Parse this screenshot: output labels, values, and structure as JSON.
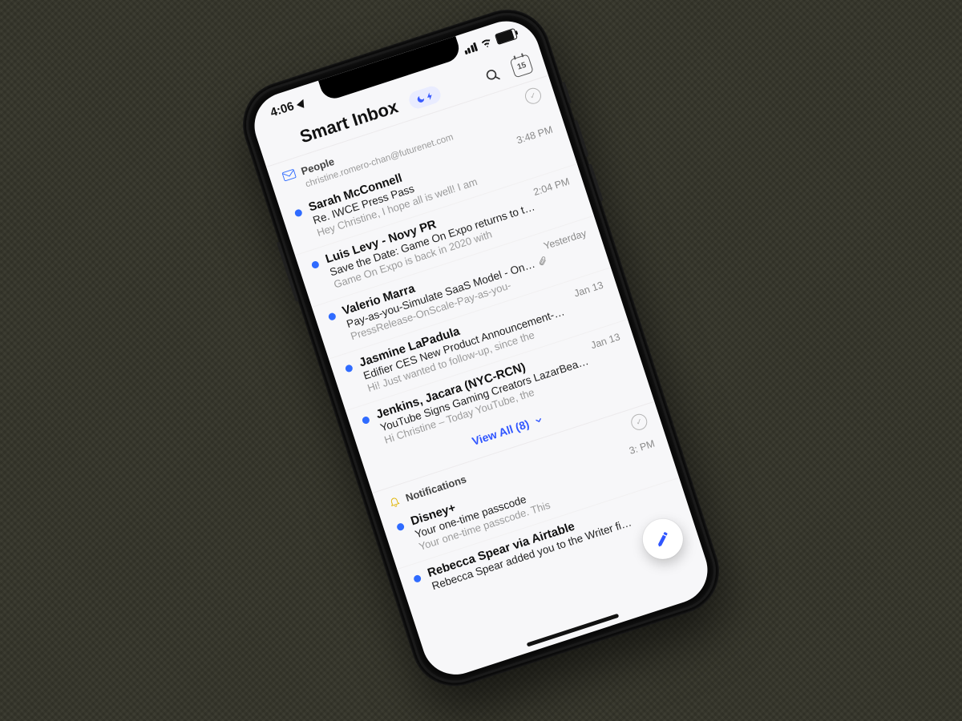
{
  "status": {
    "time": "4:06",
    "calendar_day": "15"
  },
  "header": {
    "title": "Smart Inbox"
  },
  "sections": [
    {
      "key": "people",
      "label": "People",
      "sub": "christine.romero-chan@futurenet.com",
      "view_all_label": "View All (8)",
      "messages": [
        {
          "from": "Sarah McConnell",
          "time": "3:48 PM",
          "subject": "Re. IWCE Press Pass",
          "preview": "Hey Christine, I hope all is well! I am",
          "unread": true,
          "attachment": false
        },
        {
          "from": "Luis Levy - Novy PR",
          "time": "2:04 PM",
          "subject": "Save the Date: Game On Expo returns to t…",
          "preview": "Game On Expo is back in 2020 with",
          "unread": true,
          "attachment": false
        },
        {
          "from": "Valerio Marra",
          "time": "Yesterday",
          "subject": "Pay-as-you-Simulate SaaS Model - On…",
          "preview": "PressRelease-OnScale-Pay-as-you-",
          "unread": true,
          "attachment": true
        },
        {
          "from": "Jasmine LaPadula",
          "time": "Jan 13",
          "subject": "Edifier CES New Product Announcement-…",
          "preview": "Hi! Just wanted to follow-up, since the",
          "unread": true,
          "attachment": false
        },
        {
          "from": "Jenkins, Jacara (NYC-RCN)",
          "time": "Jan 13",
          "subject": "YouTube Signs Gaming Creators LazarBea…",
          "preview": "Hi Christine – Today YouTube, the",
          "unread": true,
          "attachment": false
        }
      ]
    },
    {
      "key": "notifications",
      "label": "Notifications",
      "messages": [
        {
          "from": "Disney+",
          "time": "3:   PM",
          "subject": "Your one-time passcode",
          "preview": "Your one-time passcode. This",
          "unread": true,
          "attachment": false
        },
        {
          "from": "Rebecca Spear via Airtable",
          "time": "",
          "subject": "Rebecca Spear added you to the Writer fi…",
          "preview": "",
          "unread": true,
          "attachment": false
        }
      ]
    }
  ]
}
